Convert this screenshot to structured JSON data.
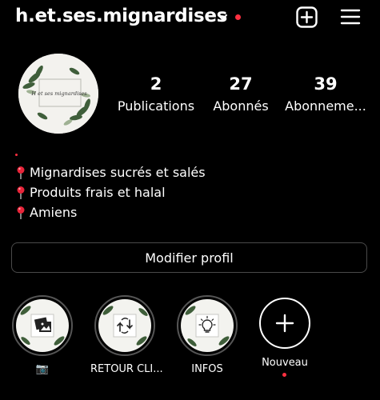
{
  "header": {
    "username": "h.et.ses.mignardises",
    "icons": [
      "chevron-down-icon",
      "notification-dot",
      "new-post-icon",
      "menu-icon"
    ]
  },
  "profile": {
    "avatar_text": "H et ses mignardises"
  },
  "stats": {
    "posts": {
      "count": "2",
      "label": "Publications"
    },
    "followers": {
      "count": "27",
      "label": "Abonnés"
    },
    "following": {
      "count": "39",
      "label": "Abonneme..."
    }
  },
  "bio": {
    "lines": [
      "Mignardises sucrés et salés",
      "Produits frais et halal",
      "Amiens"
    ],
    "icon": "pin-icon"
  },
  "actions": {
    "edit_profile": "Modifier profil"
  },
  "highlights": [
    {
      "label": "📷",
      "icon": "photos-icon"
    },
    {
      "label": "RETOUR CLI...",
      "icon": "return-icon"
    },
    {
      "label": "INFOS",
      "icon": "lightbulb-icon"
    },
    {
      "label": "Nouveau",
      "icon": "plus-icon"
    }
  ],
  "colors": {
    "background": "#000000",
    "text": "#ffffff",
    "accent_red": "#ff3040",
    "border": "#4a4a4a"
  }
}
